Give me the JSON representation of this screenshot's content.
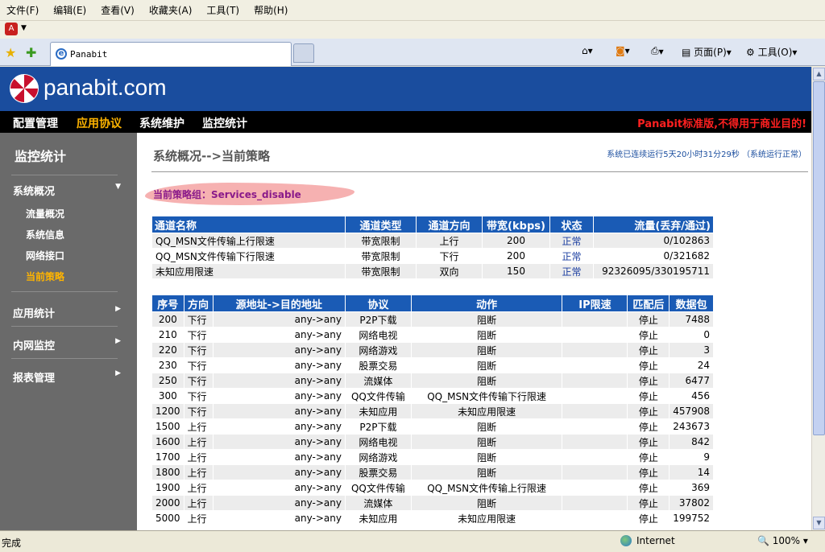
{
  "browser": {
    "menu": [
      "文件(F)",
      "编辑(E)",
      "查看(V)",
      "收藏夹(A)",
      "工具(T)",
      "帮助(H)"
    ],
    "tab_title": "Panabit",
    "toolbar": {
      "page": "页面(P)",
      "tools": "工具(O)"
    },
    "status": "完成",
    "zone": "Internet",
    "zoom": "100%"
  },
  "header": {
    "brand": "panabit.com"
  },
  "nav": {
    "items": [
      "配置管理",
      "应用协议",
      "系统维护",
      "监控统计"
    ],
    "active_index": 1,
    "warning": "Panabit标准版,不得用于商业目的!"
  },
  "sidebar": {
    "title": "监控统计",
    "groups": [
      {
        "label": "系统概况",
        "expanded": true,
        "items": [
          "流量概况",
          "系统信息",
          "网络接口",
          "当前策略"
        ],
        "active_item": 3
      },
      {
        "label": "应用统计",
        "expanded": false
      },
      {
        "label": "内网监控",
        "expanded": false
      },
      {
        "label": "报表管理",
        "expanded": false
      }
    ]
  },
  "main": {
    "title": "系统概况-->当前策略",
    "uptime": "系统已连续运行5天20小时31分29秒 （系统运行正常）",
    "policy_group": "当前策略组：Services_disable",
    "channels": {
      "headers": [
        "通道名称",
        "通道类型",
        "通道方向",
        "带宽(kbps)",
        "状态",
        "流量(丢弃/通过)"
      ],
      "rows": [
        [
          "QQ_MSN文件传输上行限速",
          "带宽限制",
          "上行",
          "200",
          "正常",
          "0/102863"
        ],
        [
          "QQ_MSN文件传输下行限速",
          "带宽限制",
          "下行",
          "200",
          "正常",
          "0/321682"
        ],
        [
          "未知应用限速",
          "带宽限制",
          "双向",
          "150",
          "正常",
          "92326095/330195711"
        ]
      ]
    },
    "rules": {
      "headers": [
        "序号",
        "方向",
        "源地址->目的地址",
        "协议",
        "动作",
        "IP限速",
        "匹配后",
        "数据包"
      ],
      "rows": [
        [
          "200",
          "下行",
          "any->any",
          "P2P下载",
          "阻断",
          "",
          "停止",
          "7488"
        ],
        [
          "210",
          "下行",
          "any->any",
          "网络电视",
          "阻断",
          "",
          "停止",
          "0"
        ],
        [
          "220",
          "下行",
          "any->any",
          "网络游戏",
          "阻断",
          "",
          "停止",
          "3"
        ],
        [
          "230",
          "下行",
          "any->any",
          "股票交易",
          "阻断",
          "",
          "停止",
          "24"
        ],
        [
          "250",
          "下行",
          "any->any",
          "流媒体",
          "阻断",
          "",
          "停止",
          "6477"
        ],
        [
          "300",
          "下行",
          "any->any",
          "QQ文件传输",
          "QQ_MSN文件传输下行限速",
          "",
          "停止",
          "456"
        ],
        [
          "1200",
          "下行",
          "any->any",
          "未知应用",
          "未知应用限速",
          "",
          "停止",
          "457908"
        ],
        [
          "1500",
          "上行",
          "any->any",
          "P2P下载",
          "阻断",
          "",
          "停止",
          "243673"
        ],
        [
          "1600",
          "上行",
          "any->any",
          "网络电视",
          "阻断",
          "",
          "停止",
          "842"
        ],
        [
          "1700",
          "上行",
          "any->any",
          "网络游戏",
          "阻断",
          "",
          "停止",
          "9"
        ],
        [
          "1800",
          "上行",
          "any->any",
          "股票交易",
          "阻断",
          "",
          "停止",
          "14"
        ],
        [
          "1900",
          "上行",
          "any->any",
          "QQ文件传输",
          "QQ_MSN文件传输上行限速",
          "",
          "停止",
          "369"
        ],
        [
          "2000",
          "上行",
          "any->any",
          "流媒体",
          "阻断",
          "",
          "停止",
          "37802"
        ],
        [
          "5000",
          "上行",
          "any->any",
          "未知应用",
          "未知应用限速",
          "",
          "停止",
          "199752"
        ]
      ]
    }
  }
}
